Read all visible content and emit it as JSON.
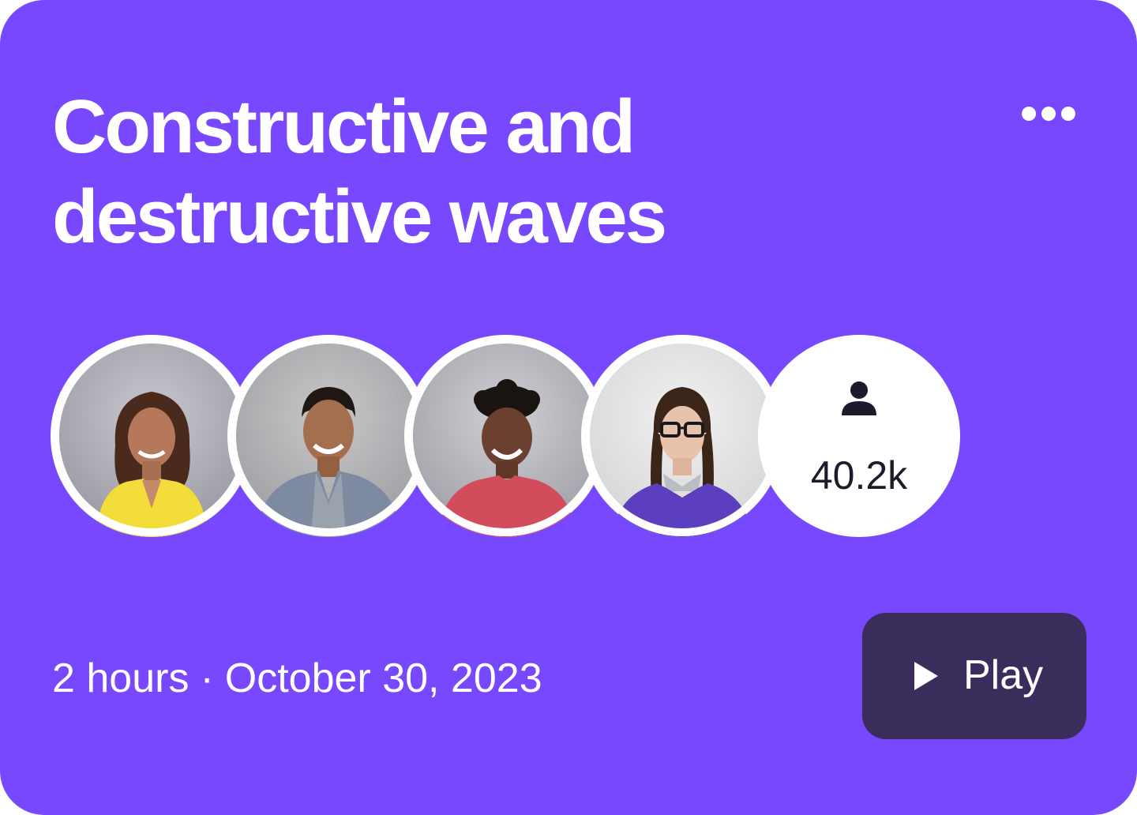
{
  "card": {
    "title_line1": "Constructive and",
    "title_line2": "destructive waves",
    "menu_icon": "more-horizontal-icon",
    "colors": {
      "background": "#7848FF",
      "play_button": "#3a2d5c",
      "text": "#ffffff"
    }
  },
  "participants": {
    "avatars": [
      {
        "name": "avatar-woman-yellow-top"
      },
      {
        "name": "avatar-man-grey-blazer"
      },
      {
        "name": "avatar-man-red-shirt"
      },
      {
        "name": "avatar-woman-glasses-purple-sweater"
      }
    ],
    "count_icon": "person-icon",
    "count": "40.2k"
  },
  "meta": {
    "duration": "2 hours",
    "separator": "·",
    "date": "October 30, 2023"
  },
  "play": {
    "icon": "play-icon",
    "label": "Play"
  }
}
